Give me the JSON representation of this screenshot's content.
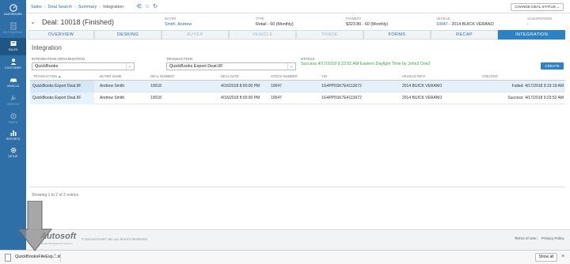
{
  "sidebar": {
    "items": [
      {
        "label": "DASHBOARD",
        "icon": "dashboard-icon"
      },
      {
        "label": "ACCOUNTING",
        "icon": "accounting-icon"
      },
      {
        "label": "SALES",
        "icon": "sales-icon"
      },
      {
        "label": "CUSTOMER",
        "icon": "customer-icon"
      },
      {
        "label": "VEHICLE",
        "icon": "vehicle-icon"
      },
      {
        "label": "SERVICE",
        "icon": "service-icon"
      },
      {
        "label": "PARTS",
        "icon": "parts-icon"
      },
      {
        "label": "REPORTS",
        "icon": "reports-icon"
      },
      {
        "label": "SETUP",
        "icon": "setup-icon"
      }
    ]
  },
  "breadcrumb": {
    "sales": "Sales",
    "deal_search": "Deal Search",
    "summary": "Summary",
    "current": "Integration"
  },
  "change_deal_status": "CHANGE DEAL STATUS",
  "deal": {
    "title": "Deal: 10018 (Finished)",
    "buyer_label": "BUYER",
    "buyer": "Smith, Andrew",
    "type_label": "TYPE",
    "type": "Retail - 60 (Monthly)",
    "payment_label": "PAYMENT",
    "payment": "$323.80 - 60 (Monthly)",
    "vehicle_label": "VEHICLE",
    "vehicle_stock": "10047",
    "vehicle_desc": " - 2014 BUICK VERANO",
    "salesperson_label": "SALESPERSON",
    "salesperson": "-"
  },
  "tabs": [
    "OVERVIEW",
    "DESKING",
    "BUYER",
    "VEHICLE",
    "TRADE",
    "FORMS",
    "RECAP",
    "INTEGRATION"
  ],
  "section_title": "Integration",
  "form": {
    "org_label": "INTEGRATION ORGANIZATION",
    "org_value": "QuickBooks",
    "txn_label": "TRANSACTION",
    "txn_value": "QuickBooks Export Deal.IIF",
    "status_label": "STATUS",
    "status_value": "Success 4/17/2018 9:23:52 AM Eastern Daylight Time by John2 Doe2",
    "create_label": "CREATE"
  },
  "table": {
    "headers": [
      "TRANSACTION",
      "BUYER NAME",
      "DEAL NUMBER",
      "DEAL DATE",
      "STOCK NUMBER",
      "VIN",
      "VEHICLE INFO",
      "CREATED"
    ],
    "rows": [
      [
        "QuickBooks Export Deal.IIF",
        "Andrew Smith",
        "10018",
        "4/16/2018 8:00:00 PM",
        "10047",
        "1G4PP5SK7E4113672",
        "2014 BUICK VERANO",
        "Failed: 4/17/2018 9:19:19 AM"
      ],
      [
        "QuickBooks Export Deal.IIF",
        "Andrew Smith",
        "10018",
        "4/16/2018 8:00:00 PM",
        "10047",
        "1G4PP5SK7E4113672",
        "2014 BUICK VERANO",
        "Success: 4/17/2018 9:23:52 AM"
      ]
    ],
    "showing": "Showing 1 to 2 of 2 entries"
  },
  "footer": {
    "logo": "Autosoft",
    "logo_sub": "Dealer Management Systems",
    "copyright": "© 2018 AUTOSOFT, INC. ALL RIGHTS RESERVED",
    "terms": "Terms of Use",
    "privacy": "Privacy Policy"
  },
  "download": {
    "filename": "QuickBooksFileExp....iif",
    "show_all": "Show all"
  },
  "colors": {
    "sidebar": "#2d6fa6",
    "accent": "#2d82c4",
    "success": "#43a047"
  }
}
